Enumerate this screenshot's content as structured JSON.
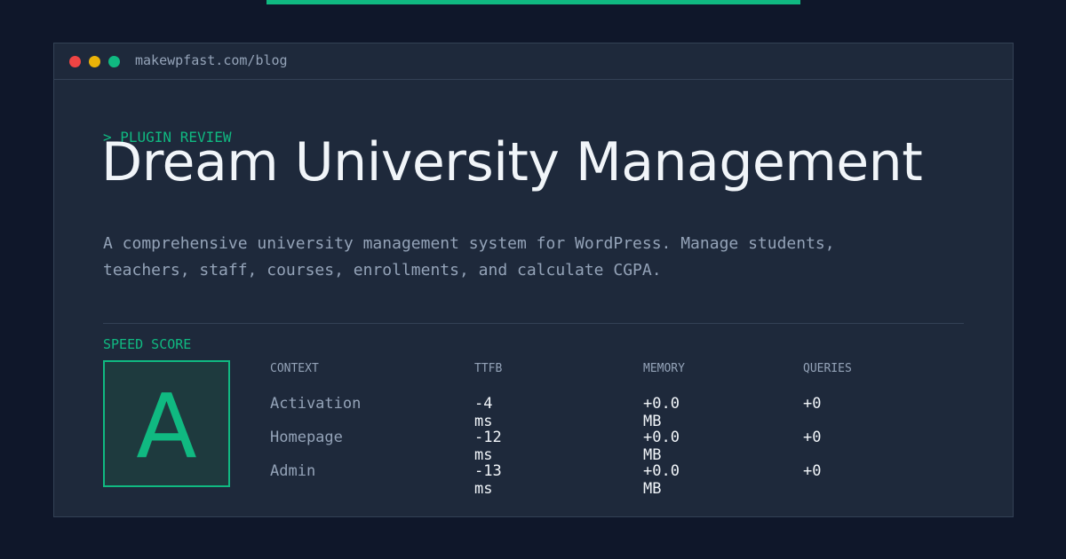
{
  "window": {
    "url": "makewpfast.com/blog"
  },
  "article": {
    "eyebrow": "> PLUGIN REVIEW",
    "title": "Dream University Management",
    "description": "A comprehensive university management system for WordPress. Manage students, teachers, staff, courses, enrollments, and calculate CGPA."
  },
  "speed": {
    "label": "SPEED SCORE",
    "grade": "A"
  },
  "metrics": {
    "headers": [
      "CONTEXT",
      "TTFB",
      "MEMORY",
      "QUERIES"
    ],
    "rows": [
      {
        "context": "Activation",
        "ttfb": "-4 ms",
        "memory": "+0.0 MB",
        "queries": "+0"
      },
      {
        "context": "Homepage",
        "ttfb": "-12 ms",
        "memory": "+0.0 MB",
        "queries": "+0"
      },
      {
        "context": "Admin",
        "ttfb": "-13 ms",
        "memory": "+0.0 MB",
        "queries": "+0"
      }
    ]
  },
  "colors": {
    "accent": "#10b981",
    "background": "#0f172a",
    "window": "#1e293b"
  }
}
